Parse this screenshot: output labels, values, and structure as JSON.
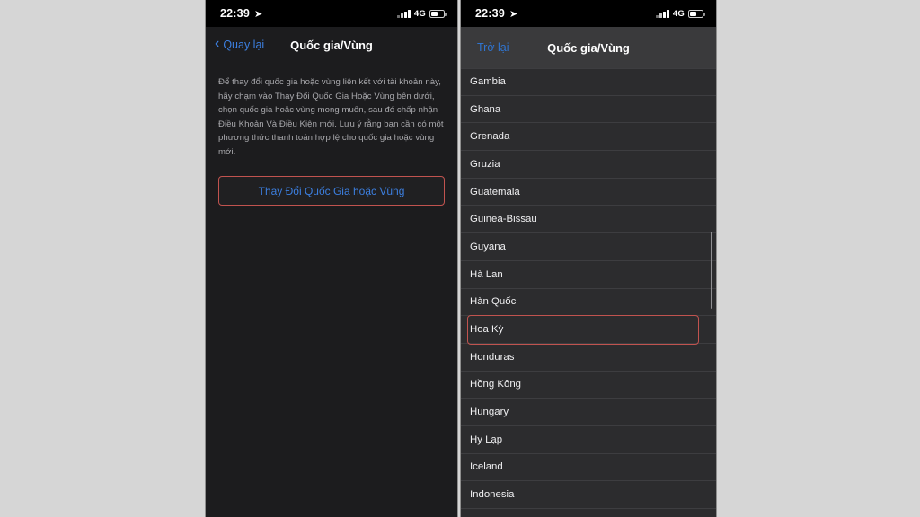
{
  "page": {
    "background_color": "#d6d6d6",
    "accent_blue": "#3c7fe0",
    "highlight_red": "#c1534f"
  },
  "left_phone": {
    "status_bar": {
      "time": "22:39",
      "location_icon": "location-arrow-icon",
      "network": "4G",
      "signal_icon": "signal-bars-icon",
      "battery_icon": "battery-icon"
    },
    "nav": {
      "back_label": "Quay lại",
      "back_icon": "chevron-left-icon",
      "title": "Quốc gia/Vùng"
    },
    "body": {
      "paragraph": "Để thay đổi quốc gia hoặc vùng liên kết với tài khoản này, hãy chạm vào Thay Đổi Quốc Gia Hoặc Vùng bên dưới, chọn quốc gia hoặc vùng mong muốn, sau đó chấp nhận Điều Khoản Và Điều Kiện mới. Lưu ý rằng bạn cần có một phương thức thanh toán hợp lệ cho quốc gia hoặc vùng mới.",
      "cta_label": "Thay Đổi Quốc Gia hoặc Vùng"
    }
  },
  "right_phone": {
    "status_bar": {
      "time": "22:39",
      "location_icon": "location-arrow-icon",
      "network": "4G",
      "signal_icon": "signal-bars-icon",
      "battery_icon": "battery-icon"
    },
    "nav": {
      "back_label": "Trở lại",
      "title": "Quốc gia/Vùng"
    },
    "list": {
      "items": [
        {
          "label": "Gambia",
          "highlighted": false
        },
        {
          "label": "Ghana",
          "highlighted": false
        },
        {
          "label": "Grenada",
          "highlighted": false
        },
        {
          "label": "Gruzia",
          "highlighted": false
        },
        {
          "label": "Guatemala",
          "highlighted": false
        },
        {
          "label": "Guinea-Bissau",
          "highlighted": false
        },
        {
          "label": "Guyana",
          "highlighted": false
        },
        {
          "label": "Hà Lan",
          "highlighted": false
        },
        {
          "label": "Hàn Quốc",
          "highlighted": false
        },
        {
          "label": "Hoa Kỳ",
          "highlighted": true
        },
        {
          "label": "Honduras",
          "highlighted": false
        },
        {
          "label": "Hồng Kông",
          "highlighted": false
        },
        {
          "label": "Hungary",
          "highlighted": false
        },
        {
          "label": "Hy Lạp",
          "highlighted": false
        },
        {
          "label": "Iceland",
          "highlighted": false
        },
        {
          "label": "Indonesia",
          "highlighted": false
        }
      ]
    }
  }
}
